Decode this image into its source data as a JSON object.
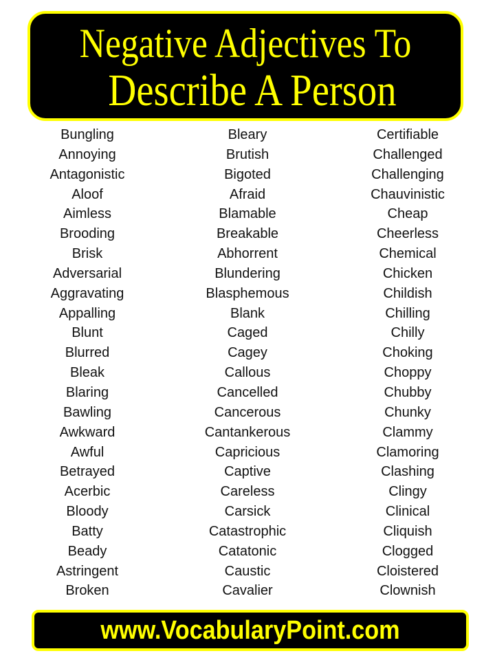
{
  "title": {
    "line1": "Negative Adjectives To",
    "line2": "Describe A Person"
  },
  "colors": {
    "accent": "#ffff00",
    "banner_bg": "#000000",
    "text": "#111111",
    "background": "#ffffff"
  },
  "columns": [
    {
      "words": [
        "Bungling",
        "Annoying",
        "Antagonistic",
        "Aloof",
        "Aimless",
        "Brooding",
        "Brisk",
        "Adversarial",
        "Aggravating",
        "Appalling",
        "Blunt",
        "Blurred",
        "Bleak",
        "Blaring",
        "Bawling",
        "Awkward",
        "Awful",
        "Betrayed",
        "Acerbic",
        "Bloody",
        "Batty",
        "Beady",
        "Astringent",
        "Broken"
      ]
    },
    {
      "words": [
        "Bleary",
        "Brutish",
        "Bigoted",
        "Afraid",
        "Blamable",
        "Breakable",
        "Abhorrent",
        "Blundering",
        "Blasphemous",
        "Blank",
        "Caged",
        "Cagey",
        "Callous",
        "Cancelled",
        "Cancerous",
        "Cantankerous",
        "Capricious",
        "Captive",
        "Careless",
        "Carsick",
        "Catastrophic",
        "Catatonic",
        "Caustic",
        "Cavalier"
      ]
    },
    {
      "words": [
        "Certifiable",
        "Challenged",
        "Challenging",
        "Chauvinistic",
        "Cheap",
        "Cheerless",
        "Chemical",
        "Chicken",
        "Childish",
        "Chilling",
        "Chilly",
        "Choking",
        "Choppy",
        "Chubby",
        "Chunky",
        "Clammy",
        "Clamoring",
        "Clashing",
        "Clingy",
        "Clinical",
        "Cliquish",
        "Clogged",
        "Cloistered",
        "Clownish"
      ]
    }
  ],
  "footer": {
    "website": "www.VocabularyPoint.com"
  }
}
